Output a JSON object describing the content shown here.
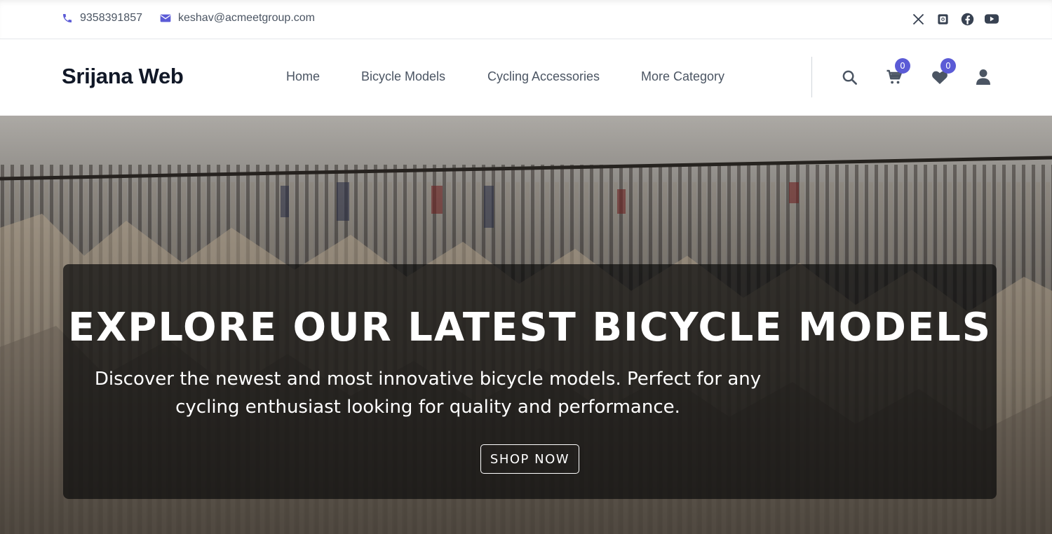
{
  "topbar": {
    "phone": "9358391857",
    "email": "keshav@acmeetgroup.com",
    "socials": [
      "x-icon",
      "instagram-icon",
      "facebook-icon",
      "youtube-icon"
    ]
  },
  "header": {
    "brand": "Srijana Web",
    "nav": [
      "Home",
      "Bicycle Models",
      "Cycling Accessories",
      "More Category"
    ],
    "cart_count": "0",
    "wishlist_count": "0"
  },
  "hero": {
    "title": "EXPLORE OUR LATEST BICYCLE MODELS",
    "subtitle": "Discover the newest and most innovative bicycle models. Perfect for any cycling enthusiast looking for quality and performance.",
    "cta": "SHOP NOW"
  },
  "colors": {
    "accent": "#5b5bd6",
    "text_muted": "#4b5563",
    "brand_text": "#111827"
  }
}
